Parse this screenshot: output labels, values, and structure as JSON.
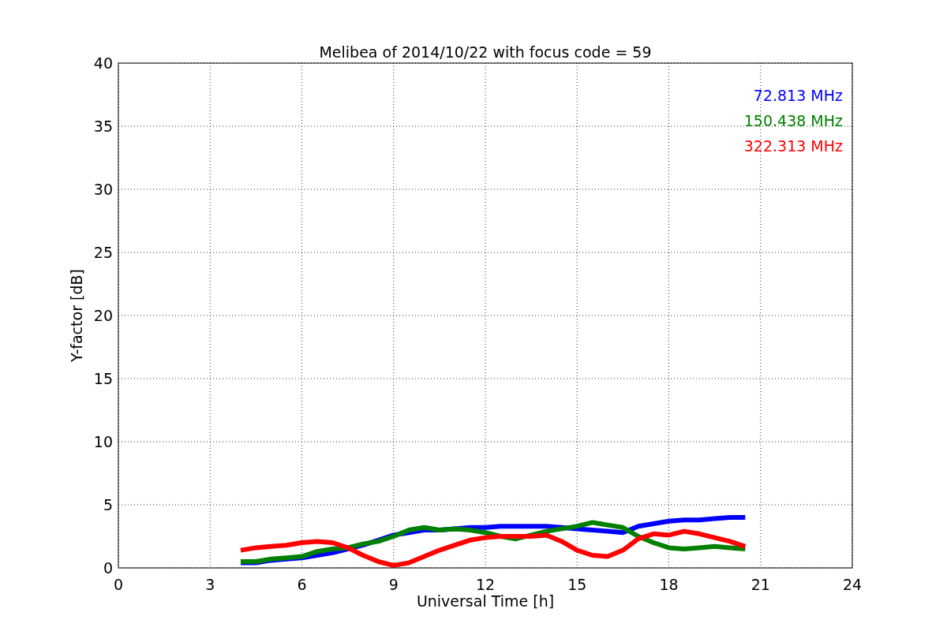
{
  "figure": {
    "chart_data": {
      "type": "line",
      "title": "Melibea of 2014/10/22 with focus code = 59",
      "xlabel": "Universal Time [h]",
      "ylabel": "Y-factor [dB]",
      "x": [
        4,
        4.5,
        5,
        5.5,
        6,
        6.5,
        7,
        7.5,
        8,
        8.5,
        9,
        9.5,
        10,
        10.5,
        11,
        11.5,
        12,
        12.5,
        13,
        13.5,
        14,
        14.5,
        15,
        15.5,
        16,
        16.5,
        17,
        17.5,
        18,
        18.5,
        19,
        19.5,
        20,
        20.5
      ],
      "series": [
        {
          "name": "72.813 MHz",
          "color": "#0000ff",
          "values": [
            0.4,
            0.4,
            0.6,
            0.7,
            0.8,
            1.0,
            1.2,
            1.5,
            1.8,
            2.2,
            2.6,
            2.8,
            3.0,
            3.0,
            3.1,
            3.2,
            3.2,
            3.3,
            3.3,
            3.3,
            3.3,
            3.2,
            3.1,
            3.0,
            2.9,
            2.8,
            3.3,
            3.5,
            3.7,
            3.8,
            3.8,
            3.9,
            4.0,
            4.0
          ]
        },
        {
          "name": "150.438 MHz",
          "color": "#008000",
          "values": [
            0.5,
            0.5,
            0.7,
            0.8,
            0.9,
            1.3,
            1.5,
            1.6,
            1.9,
            2.1,
            2.5,
            3.0,
            3.2,
            3.0,
            3.1,
            3.0,
            2.8,
            2.5,
            2.3,
            2.6,
            2.9,
            3.1,
            3.3,
            3.6,
            3.4,
            3.2,
            2.5,
            2.0,
            1.6,
            1.5,
            1.6,
            1.7,
            1.6,
            1.5
          ]
        },
        {
          "name": "322.313 MHz",
          "color": "#ff0000",
          "values": [
            1.4,
            1.6,
            1.7,
            1.8,
            2.0,
            2.1,
            2.0,
            1.6,
            1.0,
            0.5,
            0.2,
            0.4,
            0.9,
            1.4,
            1.8,
            2.2,
            2.4,
            2.5,
            2.5,
            2.5,
            2.6,
            2.1,
            1.4,
            1.0,
            0.9,
            1.4,
            2.3,
            2.7,
            2.6,
            2.9,
            2.7,
            2.4,
            2.1,
            1.7
          ]
        }
      ],
      "xlim": [
        0,
        24
      ],
      "ylim": [
        0,
        40
      ],
      "xticks": [
        0,
        3,
        6,
        9,
        12,
        15,
        18,
        21,
        24
      ],
      "yticks": [
        0,
        5,
        10,
        15,
        20,
        25,
        30,
        35,
        40
      ],
      "grid": true
    }
  }
}
